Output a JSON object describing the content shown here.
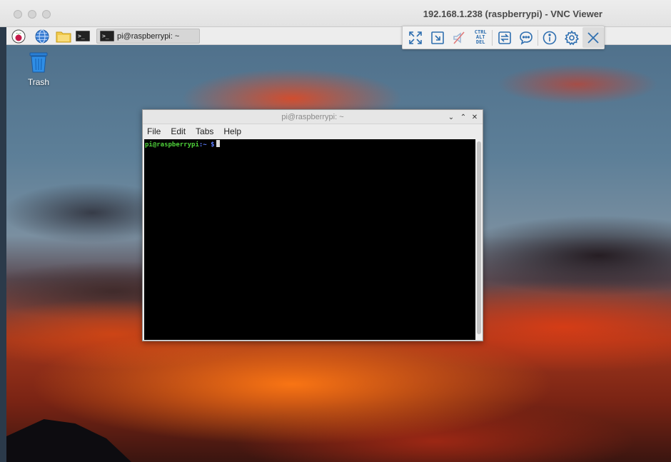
{
  "window": {
    "title": "192.168.1.238 (raspberrypi) - VNC Viewer"
  },
  "taskbar": {
    "active_task_label": "pi@raspberrypi: ~",
    "mini_terminal_glyph": ">_"
  },
  "desktop": {
    "trash_label": "Trash"
  },
  "vnc_toolbar": {
    "cad_line1": "CTRL",
    "cad_line2": "ALT",
    "cad_line3": "DEL"
  },
  "terminal": {
    "title": "pi@raspberrypi: ~",
    "menu": [
      "File",
      "Edit",
      "Tabs",
      "Help"
    ],
    "prompt_user": "pi@raspberrypi",
    "prompt_path": ":~ $",
    "controls": {
      "minimize": "⌄",
      "maximize": "⌃",
      "close": "✕"
    }
  },
  "colors": {
    "prompt_user": "#4fd23a",
    "prompt_path": "#5c7cff",
    "toolbar_icon": "#2f6fb0"
  }
}
